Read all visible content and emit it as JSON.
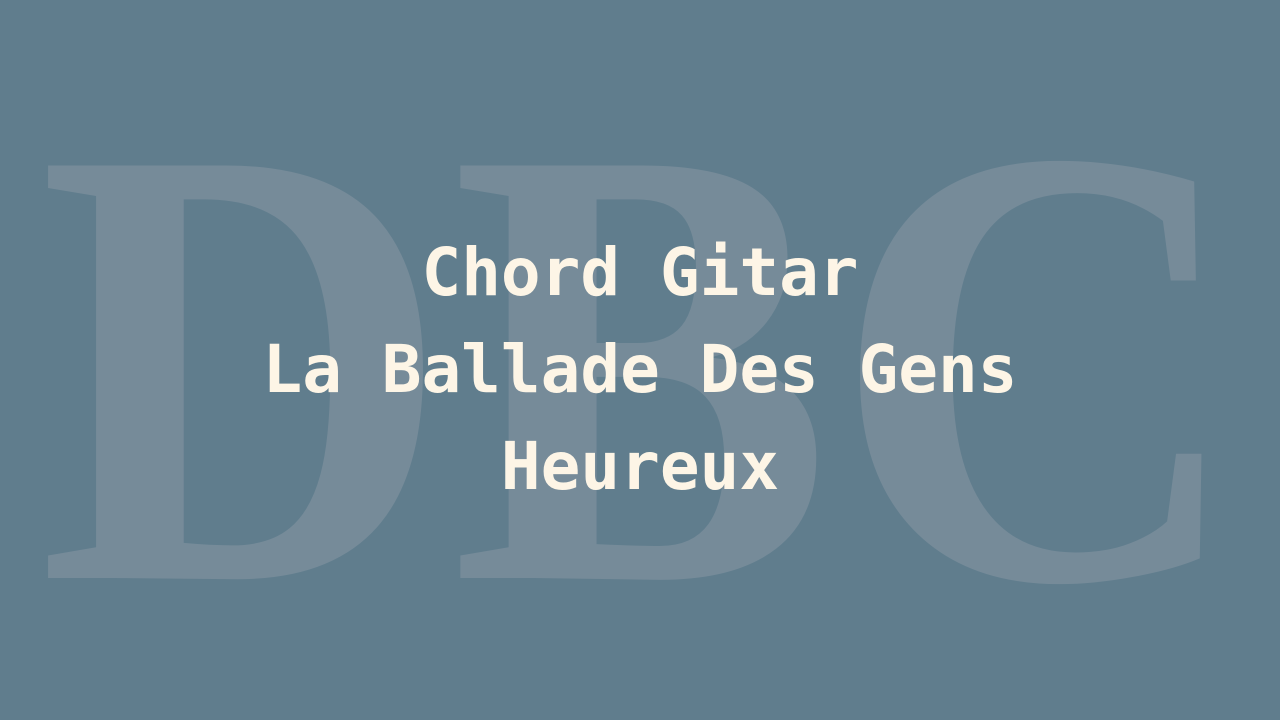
{
  "watermark": "DBC",
  "title": {
    "line1": "Chord Gitar",
    "line2": "La Ballade Des Gens",
    "line3": "Heureux"
  },
  "colors": {
    "background": "#607d8d",
    "watermark": "#7a8e9c",
    "text": "#fdf5e6"
  }
}
